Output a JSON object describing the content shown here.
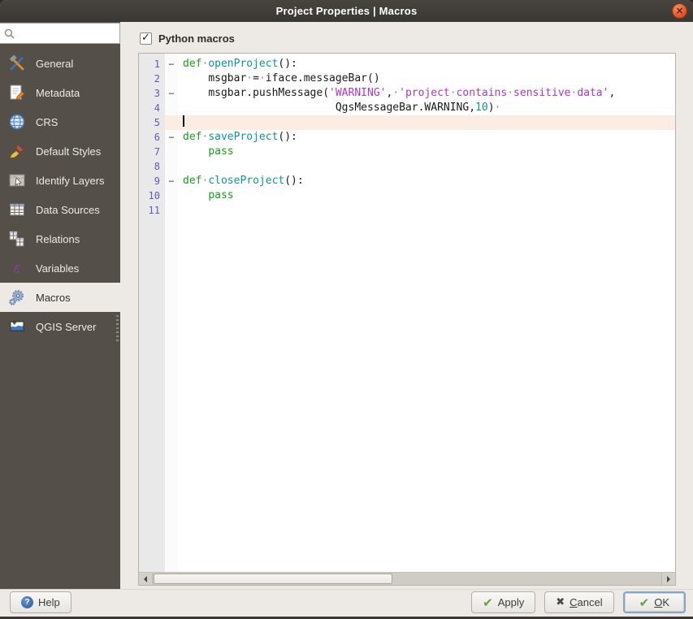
{
  "window": {
    "title": "Project Properties | Macros",
    "close_glyph": "×"
  },
  "search": {
    "placeholder": ""
  },
  "sidebar": {
    "items": [
      {
        "label": "General",
        "icon": "tools-icon",
        "selected": false
      },
      {
        "label": "Metadata",
        "icon": "metadata-icon",
        "selected": false
      },
      {
        "label": "CRS",
        "icon": "globe-icon",
        "selected": false
      },
      {
        "label": "Default Styles",
        "icon": "paintbrush-icon",
        "selected": false
      },
      {
        "label": "Identify Layers",
        "icon": "identify-icon",
        "selected": false
      },
      {
        "label": "Data Sources",
        "icon": "table-icon",
        "selected": false
      },
      {
        "label": "Relations",
        "icon": "relations-icon",
        "selected": false
      },
      {
        "label": "Variables",
        "icon": "epsilon-icon",
        "selected": false
      },
      {
        "label": "Macros",
        "icon": "gears-icon",
        "selected": true
      },
      {
        "label": "QGIS Server",
        "icon": "server-image-icon",
        "selected": false
      }
    ]
  },
  "content": {
    "python_macros_label": "Python macros",
    "checkbox_checked": true,
    "check_glyph": "✓"
  },
  "editor": {
    "cursor_line": 5,
    "fold_glyph": "−",
    "lines": [
      {
        "n": 1,
        "fold": true,
        "segs": [
          {
            "c": "kw",
            "t": "def"
          },
          {
            "c": "ws",
            "t": "·"
          },
          {
            "c": "fn",
            "t": "openProject"
          },
          {
            "c": "df",
            "t": "():"
          }
        ]
      },
      {
        "n": 2,
        "fold": false,
        "segs": [
          {
            "c": "ind",
            "t": "    "
          },
          {
            "c": "df",
            "t": "msgbar"
          },
          {
            "c": "ws",
            "t": "·"
          },
          {
            "c": "df",
            "t": "="
          },
          {
            "c": "ws",
            "t": "·"
          },
          {
            "c": "df",
            "t": "iface.messageBar()"
          }
        ]
      },
      {
        "n": 3,
        "fold": true,
        "segs": [
          {
            "c": "ind",
            "t": "    "
          },
          {
            "c": "df",
            "t": "msgbar.pushMessage("
          },
          {
            "c": "str",
            "t": "'WARNING'"
          },
          {
            "c": "df",
            "t": ","
          },
          {
            "c": "ws",
            "t": "·"
          },
          {
            "c": "str",
            "t": "'project"
          },
          {
            "c": "ws",
            "t": "·"
          },
          {
            "c": "str",
            "t": "contains"
          },
          {
            "c": "ws",
            "t": "·"
          },
          {
            "c": "str",
            "t": "sensitive"
          },
          {
            "c": "ws",
            "t": "·"
          },
          {
            "c": "str",
            "t": "data'"
          },
          {
            "c": "df",
            "t": ","
          }
        ]
      },
      {
        "n": 4,
        "fold": false,
        "segs": [
          {
            "c": "ind",
            "t": "                        "
          },
          {
            "c": "df",
            "t": "QgsMessageBar.WARNING,"
          },
          {
            "c": "num",
            "t": "10"
          },
          {
            "c": "df",
            "t": ")"
          },
          {
            "c": "ws",
            "t": "·"
          }
        ]
      },
      {
        "n": 5,
        "fold": false,
        "segs": []
      },
      {
        "n": 6,
        "fold": true,
        "segs": [
          {
            "c": "kw",
            "t": "def"
          },
          {
            "c": "ws",
            "t": "·"
          },
          {
            "c": "fn",
            "t": "saveProject"
          },
          {
            "c": "df",
            "t": "():"
          }
        ]
      },
      {
        "n": 7,
        "fold": false,
        "segs": [
          {
            "c": "ind",
            "t": "    "
          },
          {
            "c": "kw",
            "t": "pass"
          }
        ]
      },
      {
        "n": 8,
        "fold": false,
        "segs": []
      },
      {
        "n": 9,
        "fold": true,
        "segs": [
          {
            "c": "kw",
            "t": "def"
          },
          {
            "c": "ws",
            "t": "·"
          },
          {
            "c": "fn",
            "t": "closeProject"
          },
          {
            "c": "df",
            "t": "():"
          }
        ]
      },
      {
        "n": 10,
        "fold": false,
        "segs": [
          {
            "c": "ind",
            "t": "    "
          },
          {
            "c": "kw",
            "t": "pass"
          }
        ]
      },
      {
        "n": 11,
        "fold": false,
        "segs": []
      }
    ]
  },
  "footer": {
    "help": "Help",
    "help_glyph": "?",
    "apply": "Apply",
    "apply_glyph": "✔",
    "cancel_u": "C",
    "cancel_rest": "ancel",
    "cancel_glyph": "✖",
    "ok_u": "O",
    "ok_rest": "K",
    "ok_glyph": "✔"
  },
  "colors": {
    "syntax_keyword": "#1C9C1C",
    "syntax_function": "#0F9494",
    "syntax_string": "#AB37C8",
    "syntax_number": "#0F9494",
    "line_number": "#5B5BC0",
    "current_line_bg": "#FBEDE3",
    "titlebar_bg": "#3A3834",
    "close_button": "#E2562B",
    "sidebar_bg": "#545049",
    "dialog_bg": "#EDEAE6"
  }
}
